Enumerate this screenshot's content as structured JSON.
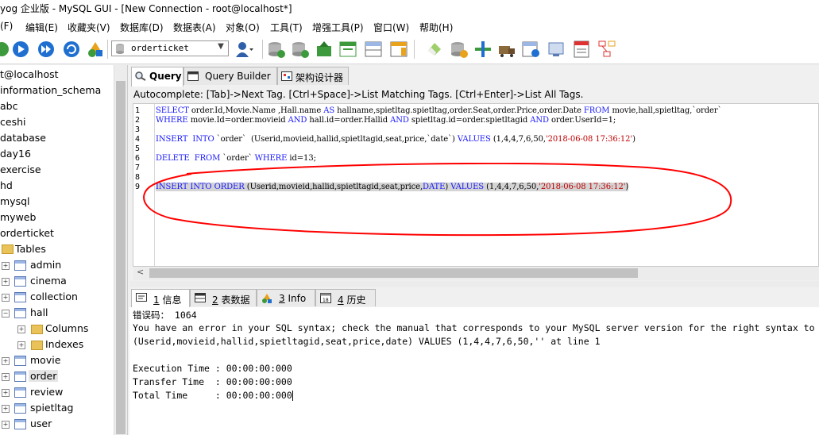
{
  "window": {
    "title": "yog 企业版 - MySQL GUI - [New Connection - root@localhost*]"
  },
  "menu": [
    "(F)",
    "编辑(E)",
    "收藏夹(V)",
    "数据库(D)",
    "数据表(A)",
    "对象(O)",
    "工具(T)",
    "增强工具(P)",
    "窗口(W)",
    "帮助(H)"
  ],
  "toolbar": {
    "db_select": "orderticket"
  },
  "sidebar": {
    "connection": "t@localhost",
    "databases": [
      "information_schema",
      "abc",
      "ceshi",
      "database",
      "day16",
      "exercise",
      "hd",
      "mysql",
      "myweb",
      "orderticket"
    ],
    "tables_label": "Tables",
    "tables": [
      "admin",
      "cinema",
      "collection",
      "hall",
      "movie",
      "order",
      "review",
      "spietltag",
      "user"
    ],
    "hall_children": [
      "Columns",
      "Indexes"
    ]
  },
  "query_tabs": [
    "Query",
    "Query Builder",
    "架构设计器"
  ],
  "autocomplete_hint": "Autocomplete: [Tab]->Next Tag. [Ctrl+Space]->List Matching Tags. [Ctrl+Enter]->List All Tags.",
  "editor": {
    "line_numbers": [
      "1",
      "2",
      "3",
      "4",
      "5",
      "6",
      "7",
      "8",
      "9"
    ],
    "l1a": "SELECT",
    "l1b": " order.Id,Movie.Name ,Hall.name ",
    "l1c": "AS",
    "l1d": " hallname,spietltag.spietltag,order.Seat,order.Price,order.Date ",
    "l1e": "FROM",
    "l1f": " movie,hall,spietltag,`order`",
    "l2a": "WHERE",
    "l2b": " movie.Id=order.movieid ",
    "l2c": "AND",
    "l2d": " hall.id=order.Hallid ",
    "l2e": "AND",
    "l2f": " spietltag.id=order.spietltagid ",
    "l2g": "AND",
    "l2h": " order.UserId=1;",
    "l4a": "INSERT  INTO",
    "l4b": " `order`  (Userid,movieid,hallid,spietltagid,seat,price,`date`) ",
    "l4c": "VALUES",
    "l4d": " (1,4,4,7,6,50,",
    "l4e": "'2018-06-08 17:36:12'",
    "l4f": ")",
    "l6a": "DELETE  FROM",
    "l6b": " `order` ",
    "l6c": "WHERE",
    "l6d": " id=13;",
    "l9a": "INSERT INTO ORDER",
    "l9b": " (Userid,movieid,hallid,spietltagid,seat,price,",
    "l9c": "DATE",
    "l9d": ") ",
    "l9e": "VALUES",
    "l9f": " (1,4,4,7,6,50,",
    "l9g": "'2018-06-08 17:36:12'",
    "l9h": ")"
  },
  "result_tabs": [
    {
      "num": "1",
      "label": " 信息"
    },
    {
      "num": "2",
      "label": " 表数据"
    },
    {
      "num": "3",
      "label": " Info"
    },
    {
      "num": "4",
      "label": " 历史"
    }
  ],
  "messages": {
    "error_code": "错误码： 1064",
    "error_line1": "You have an error in your SQL syntax; check the manual that corresponds to your MySQL server version for the right syntax to",
    "error_line2": "(Userid,movieid,hallid,spietltagid,seat,price,date) VALUES (1,4,4,7,6,50,'' at line 1",
    "exec": "Execution Time : 00:00:00:000",
    "transfer": "Transfer Time  : 00:00:00:000",
    "total": "Total Time     : 00:00:00:000"
  },
  "colors": {
    "keyword": "#1818ff",
    "string": "#c00000",
    "annotation": "#ff0000"
  }
}
